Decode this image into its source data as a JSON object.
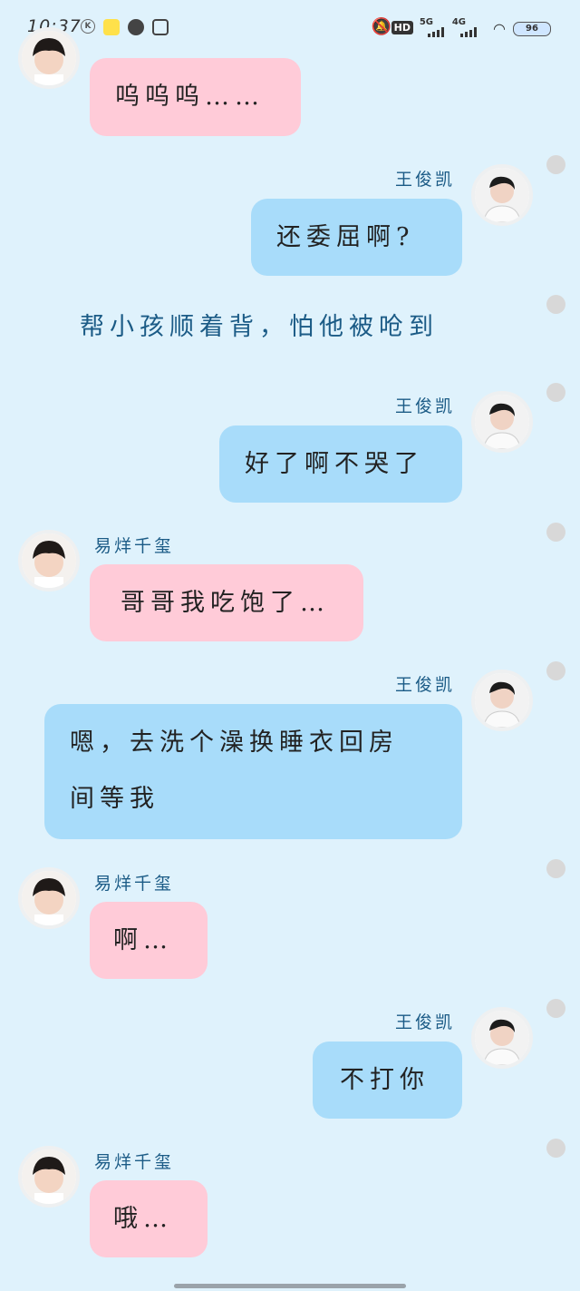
{
  "status_bar": {
    "time": "10:37",
    "k_label": "K",
    "hd_label": "HD",
    "net1": "5G",
    "net2": "4G",
    "battery": "96"
  },
  "chat": {
    "names": {
      "self": "王俊凯",
      "other": "易烊千玺"
    },
    "messages": [
      {
        "text": "呜呜呜……"
      },
      {
        "text": "还委屈啊?"
      },
      {
        "text": "好了啊不哭了"
      },
      {
        "text": "哥哥我吃饱了…"
      },
      {
        "line1": "嗯，去洗个澡换睡衣回房",
        "line2": "间等我"
      },
      {
        "text": "啊…"
      },
      {
        "text": "不打你"
      },
      {
        "text": "哦…"
      }
    ],
    "narration": "帮小孩顺着背，怕他被呛到"
  },
  "colors": {
    "background": "#dff2fc",
    "pink_bubble": "#ffcbd8",
    "blue_bubble": "#a8dcfa",
    "name_text": "#1b5b86"
  }
}
